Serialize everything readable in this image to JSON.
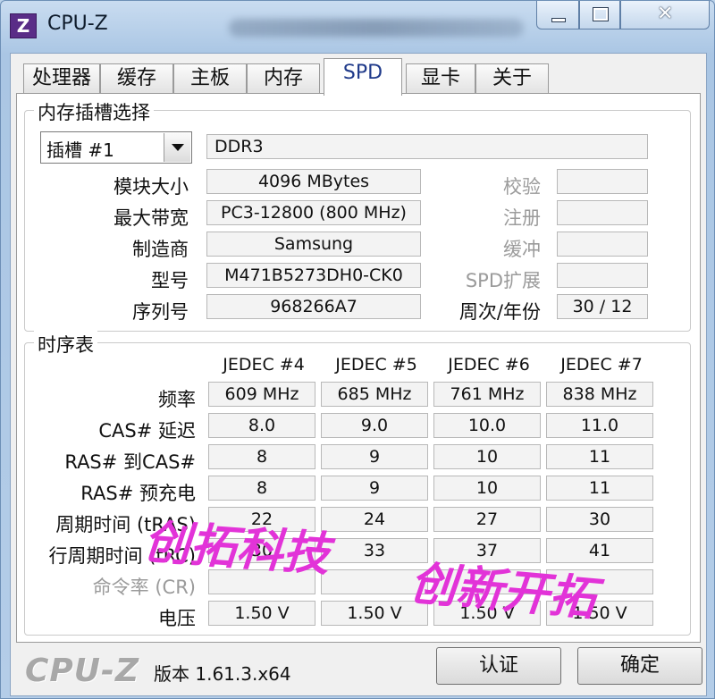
{
  "window": {
    "title": "CPU-Z",
    "app_icon_letter": "Z",
    "controls": [
      "minimize",
      "maximize",
      "close"
    ]
  },
  "tabs": [
    {
      "label": "处理器",
      "active": false
    },
    {
      "label": "缓存",
      "active": false
    },
    {
      "label": "主板",
      "active": false
    },
    {
      "label": "内存",
      "active": false
    },
    {
      "label": "SPD",
      "active": true
    },
    {
      "label": "显卡",
      "active": false
    },
    {
      "label": "关于",
      "active": false
    }
  ],
  "slot_group": {
    "title": "内存插槽选择",
    "slot_select": "插槽 #1",
    "memory_type": "DDR3",
    "labels": {
      "module_size": "模块大小",
      "max_bandwidth": "最大带宽",
      "manufacturer": "制造商",
      "part_number": "型号",
      "serial_number": "序列号",
      "correction": "校验",
      "registered": "注册",
      "buffered": "缓冲",
      "spd_ext": "SPD扩展",
      "week_year": "周次/年份"
    },
    "values": {
      "module_size": "4096 MBytes",
      "max_bandwidth": "PC3-12800 (800 MHz)",
      "manufacturer": "Samsung",
      "part_number": "M471B5273DH0-CK0",
      "serial_number": "968266A7",
      "correction": "",
      "registered": "",
      "buffered": "",
      "spd_ext": "",
      "week_year": "30 / 12"
    }
  },
  "timings_group": {
    "title": "时序表",
    "columns": [
      "JEDEC #4",
      "JEDEC #5",
      "JEDEC #6",
      "JEDEC #7"
    ],
    "rows": [
      {
        "label": "频率",
        "dim": false,
        "values": [
          "609 MHz",
          "685 MHz",
          "761 MHz",
          "838 MHz"
        ]
      },
      {
        "label": "CAS# 延迟",
        "dim": false,
        "values": [
          "8.0",
          "9.0",
          "10.0",
          "11.0"
        ]
      },
      {
        "label": "RAS# 到CAS#",
        "dim": false,
        "values": [
          "8",
          "9",
          "10",
          "11"
        ]
      },
      {
        "label": "RAS# 预充电",
        "dim": false,
        "values": [
          "8",
          "9",
          "10",
          "11"
        ]
      },
      {
        "label": "周期时间 (tRAS)",
        "dim": false,
        "values": [
          "22",
          "24",
          "27",
          "30"
        ]
      },
      {
        "label": "行周期时间 (tRC)",
        "dim": false,
        "values": [
          "30",
          "33",
          "37",
          "41"
        ]
      },
      {
        "label": "命令率 (CR)",
        "dim": true,
        "values": [
          "",
          "",
          "",
          ""
        ]
      },
      {
        "label": "电压",
        "dim": false,
        "values": [
          "1.50 V",
          "1.50 V",
          "1.50 V",
          "1.50 V"
        ]
      }
    ]
  },
  "footer": {
    "logo": "CPU-Z",
    "version": "版本 1.61.3.x64",
    "validate_button": "认证",
    "ok_button": "确定"
  },
  "watermark": {
    "line1": "创拓科技",
    "line2": "创新开拓",
    "color": "#e233d8"
  }
}
